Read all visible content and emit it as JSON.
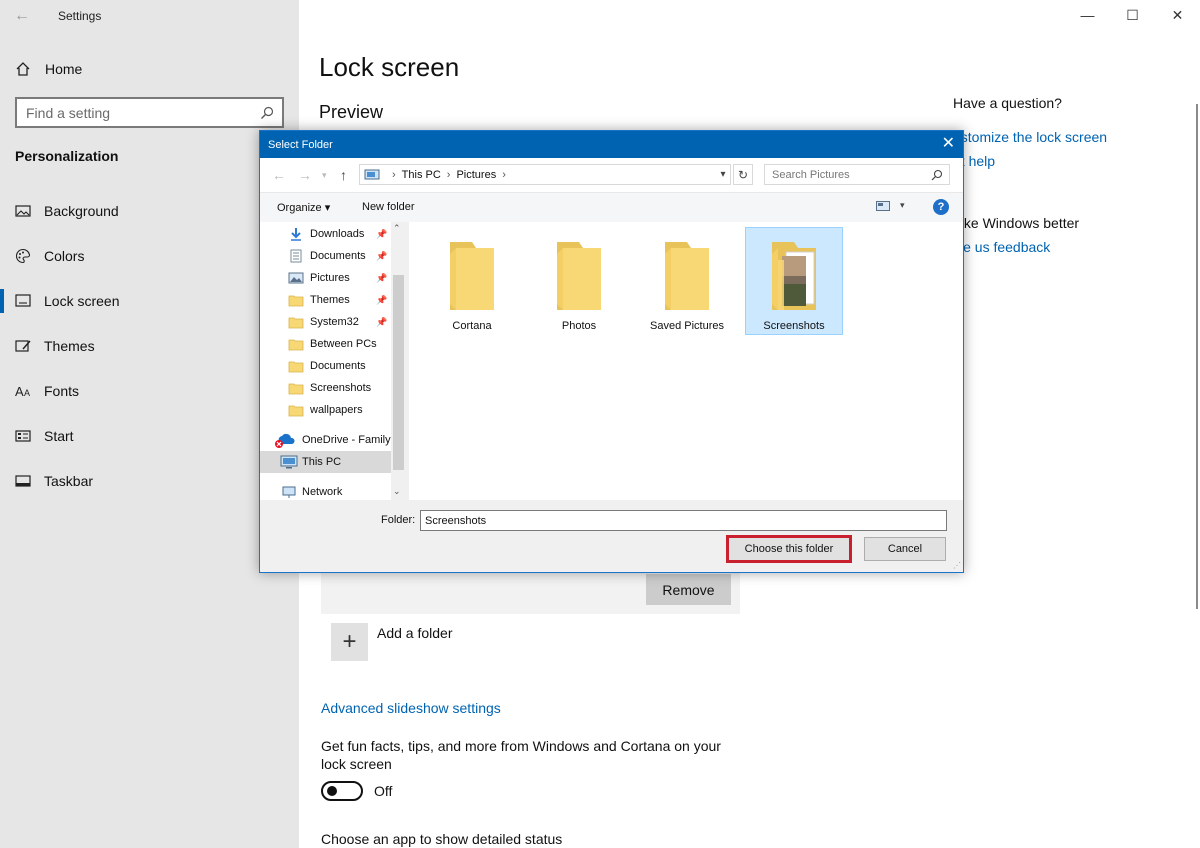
{
  "window": {
    "app_title": "Settings",
    "minimize": "—",
    "maximize": "☐",
    "close": "✕"
  },
  "sidebar": {
    "home_label": "Home",
    "search_placeholder": "Find a setting",
    "section_title": "Personalization",
    "items": [
      {
        "label": "Background",
        "icon": "picture-icon"
      },
      {
        "label": "Colors",
        "icon": "palette-icon"
      },
      {
        "label": "Lock screen",
        "icon": "lock-screen-icon",
        "active": true
      },
      {
        "label": "Themes",
        "icon": "brush-icon"
      },
      {
        "label": "Fonts",
        "icon": "font-icon"
      },
      {
        "label": "Start",
        "icon": "start-icon"
      },
      {
        "label": "Taskbar",
        "icon": "taskbar-icon"
      }
    ]
  },
  "main": {
    "page_title": "Lock screen",
    "preview_title": "Preview",
    "remove_label": "Remove",
    "add_folder_label": "Add a folder",
    "advanced_link": "Advanced slideshow settings",
    "fun_facts_text": "Get fun facts, tips, and more from Windows and Cortana on your lock screen",
    "toggle_label": "Off",
    "choose_app_text": "Choose an app to show detailed status"
  },
  "help_panel": {
    "question": "Have a question?",
    "link1": "ustomize the lock screen",
    "link2": "et help",
    "better_title": "lake Windows better",
    "feedback_link": "ive us feedback"
  },
  "dialog": {
    "title": "Select Folder",
    "breadcrumb": [
      "This PC",
      "Pictures"
    ],
    "search_placeholder": "Search Pictures",
    "organize_label": "Organize ▾",
    "new_folder_label": "New folder",
    "help_label": "?",
    "tree": [
      {
        "label": "Downloads",
        "icon": "download-icon",
        "pinned": true
      },
      {
        "label": "Documents",
        "icon": "document-icon",
        "pinned": true
      },
      {
        "label": "Pictures",
        "icon": "pictures-icon",
        "pinned": true
      },
      {
        "label": "Themes",
        "icon": "folder-icon",
        "pinned": true
      },
      {
        "label": "System32",
        "icon": "folder-icon",
        "pinned": true
      },
      {
        "label": "Between PCs",
        "icon": "folder-icon",
        "pinned": false
      },
      {
        "label": "Documents",
        "icon": "folder-icon",
        "pinned": false
      },
      {
        "label": "Screenshots",
        "icon": "folder-icon",
        "pinned": false
      },
      {
        "label": "wallpapers",
        "icon": "folder-icon",
        "pinned": false
      },
      {
        "label": "OneDrive - Family",
        "icon": "onedrive-icon",
        "pinned": false
      },
      {
        "label": "This PC",
        "icon": "computer-icon",
        "pinned": false,
        "selected": true
      },
      {
        "label": "Network",
        "icon": "network-icon",
        "pinned": false
      }
    ],
    "files": [
      {
        "name": "Cortana"
      },
      {
        "name": "Photos"
      },
      {
        "name": "Saved Pictures"
      },
      {
        "name": "Screenshots",
        "selected": true
      }
    ],
    "folder_label": "Folder:",
    "folder_value": "Screenshots",
    "choose_button": "Choose this folder",
    "cancel_button": "Cancel"
  },
  "colors": {
    "accent": "#0063b1",
    "highlight_border": "#c8202f",
    "folder_yellow": "#f8d775"
  }
}
